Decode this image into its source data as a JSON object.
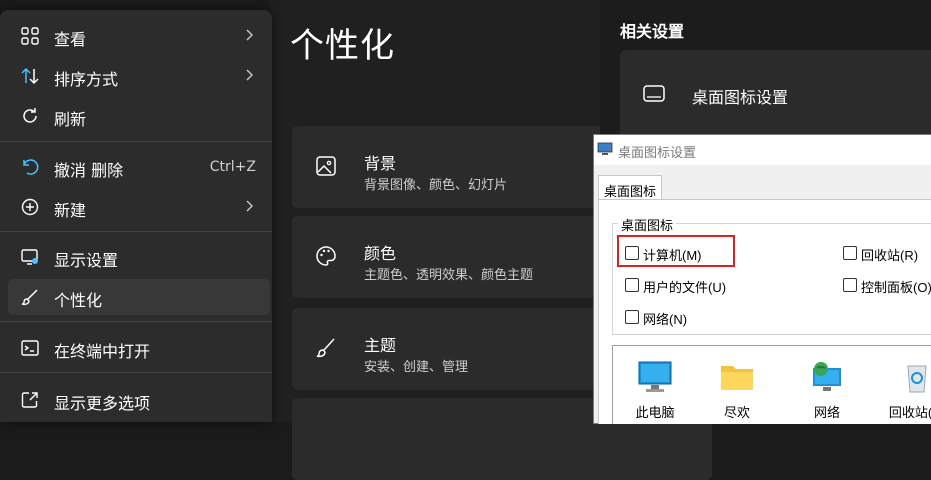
{
  "settings": {
    "title": "个性化",
    "cards": [
      {
        "icon": "image-icon",
        "title": "背景",
        "subtitle": "背景图像、颜色、幻灯片"
      },
      {
        "icon": "palette-icon",
        "title": "颜色",
        "subtitle": "主题色、透明效果、颜色主题"
      },
      {
        "icon": "brush-icon",
        "title": "主题",
        "subtitle": "安装、创建、管理"
      }
    ]
  },
  "related": {
    "title": "相关设置",
    "item": "桌面图标设置"
  },
  "menu": {
    "items": [
      {
        "icon": "grid-icon",
        "label": "查看",
        "chevron": true
      },
      {
        "icon": "sort-icon",
        "label": "排序方式",
        "chevron": true
      },
      {
        "icon": "refresh-icon",
        "label": "刷新"
      },
      {
        "icon": "undo-icon",
        "label": "撤消 删除",
        "shortcut": "Ctrl+Z"
      },
      {
        "icon": "plus-circle-icon",
        "label": "新建",
        "chevron": true
      },
      {
        "icon": "display-settings-icon",
        "label": "显示设置"
      },
      {
        "icon": "brush-icon",
        "label": "个性化"
      },
      {
        "icon": "terminal-icon",
        "label": "在终端中打开"
      },
      {
        "icon": "share-icon",
        "label": "显示更多选项"
      }
    ]
  },
  "dialog": {
    "title": "桌面图标设置",
    "tab": "桌面图标",
    "group_label": "桌面图标",
    "checkboxes": {
      "computer": "计算机(M)",
      "recycle": "回收站(R)",
      "userfiles": "用户的文件(U)",
      "control": "控制面板(O)",
      "network": "网络(N)"
    },
    "icons": [
      "此电脑",
      "尽欢",
      "网络",
      "回收站(满"
    ]
  },
  "colors": {
    "accent": "#e02020",
    "menu_bg": "#2c2c2c",
    "settings_bg": "#202020"
  }
}
